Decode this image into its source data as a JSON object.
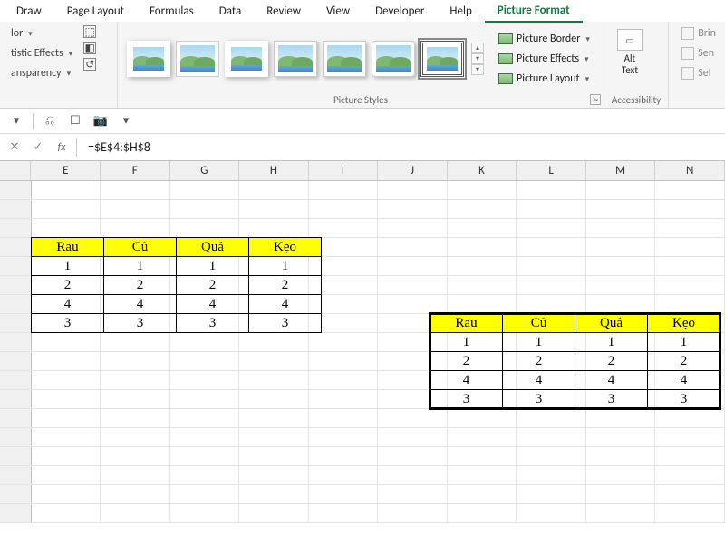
{
  "ribbon_tabs": {
    "draw": "Draw",
    "page_layout": "Page Layout",
    "formulas": "Formulas",
    "data": "Data",
    "review": "Review",
    "view": "View",
    "developer": "Developer",
    "help": "Help",
    "picture_format": "Picture Format"
  },
  "adjust": {
    "color": "lor",
    "artistic": "tistic Effects",
    "transparency": "ansparency"
  },
  "picture_styles": {
    "border": "Picture Border",
    "effects": "Picture Effects",
    "layout": "Picture Layout",
    "group_label": "Picture Styles"
  },
  "accessibility": {
    "alt_text": "Alt\nText",
    "group_label": "Accessibility"
  },
  "insert": {
    "bring": "Brin",
    "sen": "Sen",
    "sel": "Sel"
  },
  "formula_bar": {
    "fx": "fx",
    "value": "=$E$4:$H$8"
  },
  "columns": [
    "E",
    "F",
    "G",
    "H",
    "I",
    "J",
    "K",
    "L",
    "M",
    "N"
  ],
  "chart_data": {
    "type": "table",
    "headers": [
      "Rau",
      "Củ",
      "Quả",
      "Kẹo"
    ],
    "rows": [
      [
        1,
        1,
        1,
        1
      ],
      [
        2,
        2,
        2,
        2
      ],
      [
        4,
        4,
        4,
        4
      ],
      [
        3,
        3,
        3,
        3
      ]
    ]
  }
}
